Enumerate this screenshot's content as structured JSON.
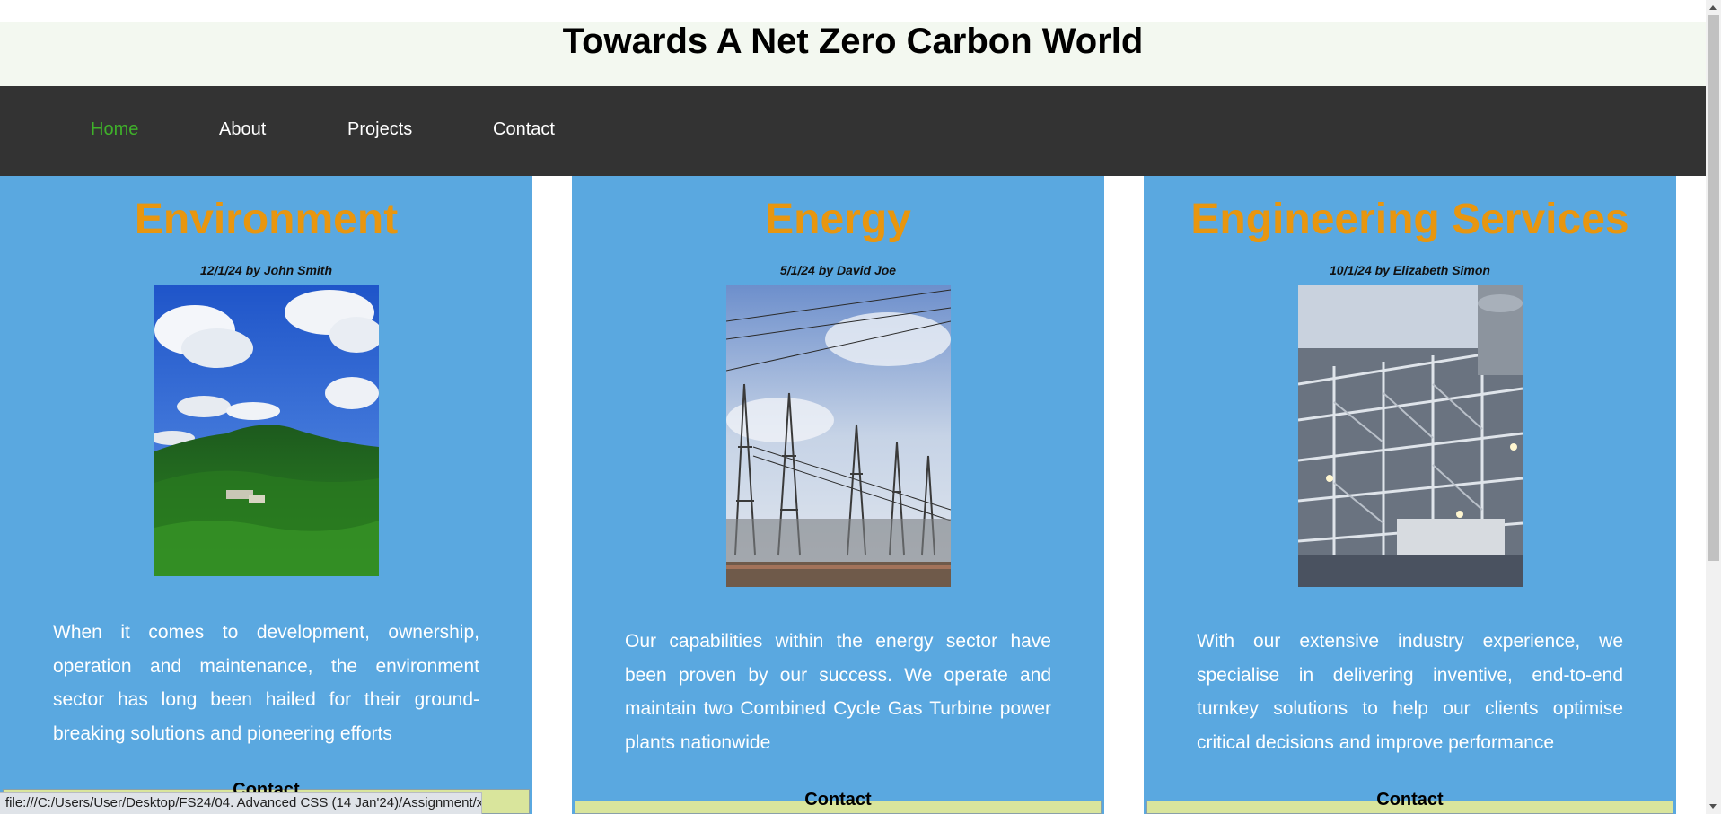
{
  "page": {
    "title": "Towards A Net Zero Carbon World"
  },
  "nav": {
    "items": [
      {
        "label": "Home",
        "active": true
      },
      {
        "label": "About",
        "active": false
      },
      {
        "label": "Projects",
        "active": false
      },
      {
        "label": "Contact",
        "active": false
      }
    ]
  },
  "cards": [
    {
      "title": "Environment",
      "meta": "12/1/24 by John Smith",
      "image": "forest-hill-photo",
      "text": "When it comes to development, ownership, operation and maintenance, the environment sector has long been hailed for their ground-breaking solutions and pioneering efforts",
      "contact_label": "Contact"
    },
    {
      "title": "Energy",
      "meta": "5/1/24 by David Joe",
      "image": "power-transmission-towers-photo",
      "text": "Our capabilities within the energy sector have been proven by our success. We operate and maintain two Combined Cycle Gas Turbine power plants nationwide",
      "contact_label": "Contact"
    },
    {
      "title": "Engineering Services",
      "meta": "10/1/24 by Elizabeth Simon",
      "image": "industrial-plant-photo",
      "text": "With our extensive industry experience, we specialise in delivering inventive, end-to-end turnkey solutions to help our clients optimise critical decisions and improve performance",
      "contact_label": "Contact"
    }
  ],
  "status_bar": {
    "url": "file:///C:/Users/User/Desktop/FS24/04. Advanced CSS (14 Jan'24)/Assignment/x"
  },
  "colors": {
    "header_bg": "#f3f8f0",
    "nav_bg": "#333333",
    "nav_active": "#3fb12a",
    "card_bg": "#5aa8e0",
    "card_title": "#e8960f",
    "contact_bg": "#d9e59c"
  }
}
